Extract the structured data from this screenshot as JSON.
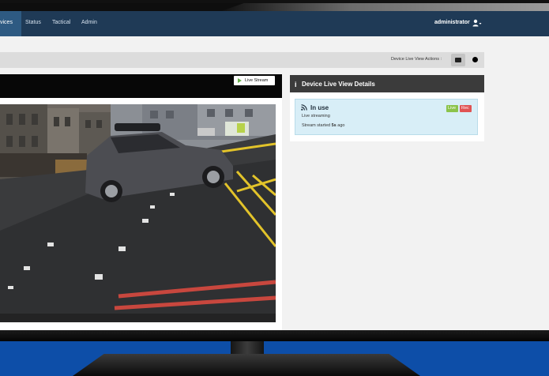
{
  "navbar": {
    "items": [
      "vices",
      "Status",
      "Tactical",
      "Admin"
    ],
    "user": "administrator"
  },
  "actions": {
    "label": "Device Live View Actions :",
    "snapshot_icon": "camera-icon",
    "record_icon": "record-dot-icon"
  },
  "video": {
    "live_button": "Live Stream"
  },
  "details": {
    "title": "Device Live View Details",
    "status": "In use",
    "sub_status": "Live streaming",
    "started_prefix": "Stream started",
    "started_value": "5s",
    "started_suffix": "ago",
    "badge_live": "Live",
    "badge_rec": "Rec"
  },
  "colors": {
    "navbar": "#1f3a56",
    "status_card": "#d8eef7",
    "badge_live": "#8bc34a",
    "badge_rec": "#e05353",
    "stage_blue": "#0d4ea8"
  }
}
